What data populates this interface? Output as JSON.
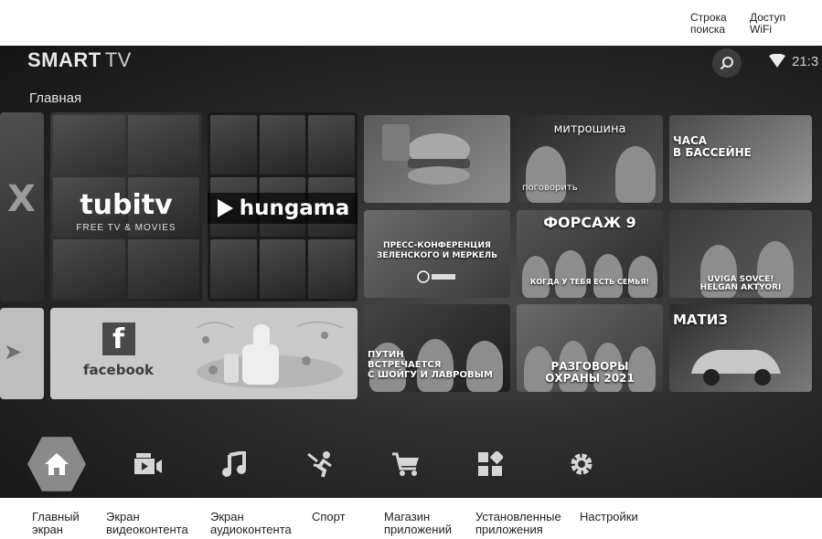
{
  "callouts": {
    "search": "Строка\nпоиска",
    "wifi": "Доступ\nWiFi"
  },
  "header": {
    "brand_bold": "SMART",
    "brand_thin": "TV",
    "clock": "21:3",
    "section_title": "Главная"
  },
  "tiles": {
    "partial_left": "X",
    "tubi": {
      "name": "tubitv",
      "sub": "FREE TV & MOVIES"
    },
    "hungama": {
      "name": "hungama"
    },
    "facebook": {
      "letter": "f",
      "name": "facebook"
    },
    "mitroshina": "митрошина",
    "mitroshina_sub": "поговорить",
    "chasa": "ЧАСА\nВ БАССЕЙНЕ",
    "press": "ПРЕСС-КОНФЕРЕНЦИЯ\nЗЕЛЕНСКОГО И МЕРКЕЛЬ",
    "forsazh": "ФОРСАЖ 9",
    "forsazh_sub": "КОГДА У ТЕБЯ ЕСТЬ СЕМЬЯ!",
    "uviga": "UVIGA SOVCE!\nHELGAN AKTYORI",
    "putin": "ПУТИН\nВСТРЕЧАЕТСЯ\nС ШОЙГУ И ЛАВРОВЫМ",
    "razgovory": "РАЗГОВОРЫ\nОХРАНЫ 2021",
    "matiz": "МАТИЗ"
  },
  "nav": {
    "labels": [
      "Главный\nэкран",
      "Экран\nвидеоконтента",
      "Экран\nаудиоконтента",
      "Спорт",
      "Магазин\nприложений",
      "Установленные\nприложения",
      "Настройки"
    ]
  },
  "colors": {
    "screen_bg": "#2c2c2c",
    "home_highlight": "#8a8a8a",
    "nav_icon": "#d6d6d6"
  },
  "icons": [
    "search-icon",
    "wifi-icon",
    "home-icon",
    "video-icon",
    "music-icon",
    "sport-icon",
    "cart-icon",
    "apps-icon",
    "settings-icon"
  ]
}
